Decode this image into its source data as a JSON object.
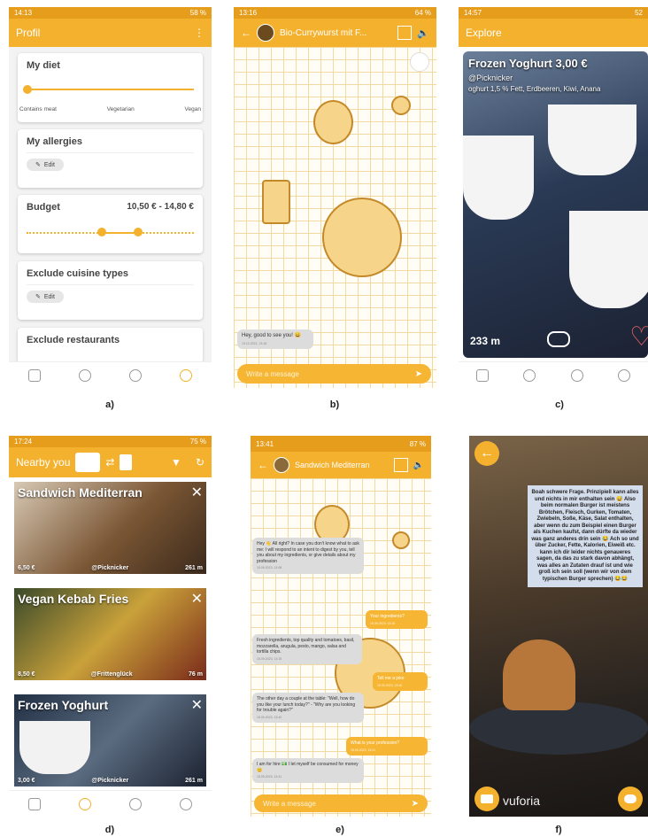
{
  "colors": {
    "accent": "#f4b12e",
    "status": "#e69d1b"
  },
  "a": {
    "status_time": "14:13",
    "status_battery": "58 %",
    "title": "Profil",
    "menu_icon": "more-vert-icon",
    "diet": {
      "label": "My diet",
      "min": "Contains meat",
      "mid": "Vegetarian",
      "max": "Vegan",
      "level": 0
    },
    "allergies": {
      "label": "My allergies",
      "edit": "Edit"
    },
    "budget": {
      "label": "Budget",
      "value": "10,50 € - 14,80 €"
    },
    "cuisine": {
      "label": "Exclude cuisine types",
      "edit": "Edit"
    },
    "restaurants": {
      "label": "Exclude restaurants"
    },
    "caption": "a)"
  },
  "b": {
    "status_time": "13:16",
    "status_battery": "64 %",
    "title": "Bio-Currywurst mit F...",
    "message": {
      "text": "Hey, good to see you! 😀",
      "time": "13.12.2021, 13:16"
    },
    "input_placeholder": "Write a message",
    "caption": "b)"
  },
  "c": {
    "status_time": "14:57",
    "status_battery": "52",
    "title": "Explore",
    "item_title": "Frozen Yoghurt 3,00 €",
    "user": "@Picknicker",
    "ingredients": "oghurt 1,5 % Fett, Erdbeeren, Kiwi, Anana",
    "distance": "233 m",
    "caption": "c)"
  },
  "d": {
    "status_time": "17:24",
    "status_battery": "75 %",
    "title": "Nearby you",
    "tiles": [
      {
        "name": "Sandwich Mediterran",
        "price": "6,50 €",
        "user": "@Picknicker",
        "distance": "261 m"
      },
      {
        "name": "Vegan Kebab Fries",
        "price": "8,50 €",
        "user": "@Frittenglück",
        "distance": "76 m"
      },
      {
        "name": "Frozen Yoghurt",
        "price": "3,00 €",
        "user": "@Picknicker",
        "distance": "261 m"
      }
    ],
    "caption": "d)"
  },
  "e": {
    "status_time": "13:41",
    "status_battery": "87 %",
    "title": "Sandwich Mediterran",
    "messages": [
      {
        "dir": "in",
        "text": "Hey 👋 All right? In case you don't know what to ask me: I will respond to an intent to digest by you, tell you about my ingredients, or give details about my profession",
        "time": "15.09.2023, 13:08"
      },
      {
        "dir": "out",
        "text": "Your ingredients?",
        "time": "15.09.2023, 13:15"
      },
      {
        "dir": "in",
        "text": "Fresh ingredients, top quality and tomatoes, basil, mozzarella, arugula, pesto, mango, salsa and tortilla chips.",
        "time": "15.09.2023, 13:15"
      },
      {
        "dir": "out",
        "text": "Tell me a joke",
        "time": "15.09.2023, 13:40"
      },
      {
        "dir": "in",
        "text": "The other day a couple at the table: \"Well, how do you like your lunch today?\" - \"Why are you looking for trouble again?\"",
        "time": "15.09.2023, 13:40"
      },
      {
        "dir": "out",
        "text": "What is your profession?",
        "time": "15.09.2023, 13:41"
      },
      {
        "dir": "in",
        "text": "I am for hire 💵 I let myself be consumed for money 😊",
        "time": "15.09.2023, 13:41"
      }
    ],
    "input_placeholder": "Write a message",
    "caption": "e)"
  },
  "f": {
    "speech": "Boah schwere Frage. Prinzipiell kann alles und nichts in mir enthalten sein 😅 Also beim normalen Burger ist meistens Brötchen, Fleisch, Gurken, Tomaten, Zwiebeln, Soße, Käse, Salat enthalten, aber wenn du zum Beispiel einen Burger als Kuchen kaufst, dann dürfte da wieder was ganz anderes drin sein 😂 Ach so und über Zucker, Fette, Kalorien, Eiweiß etc. kann ich dir leider nichts genaueres sagen, da das zu stark davon abhängt, was alles an Zutaten drauf ist und wie groß ich sein soll (wenn wir von dem typischen Burger sprechen) 😂😂",
    "watermark": "vuforia",
    "caption": "f)"
  }
}
